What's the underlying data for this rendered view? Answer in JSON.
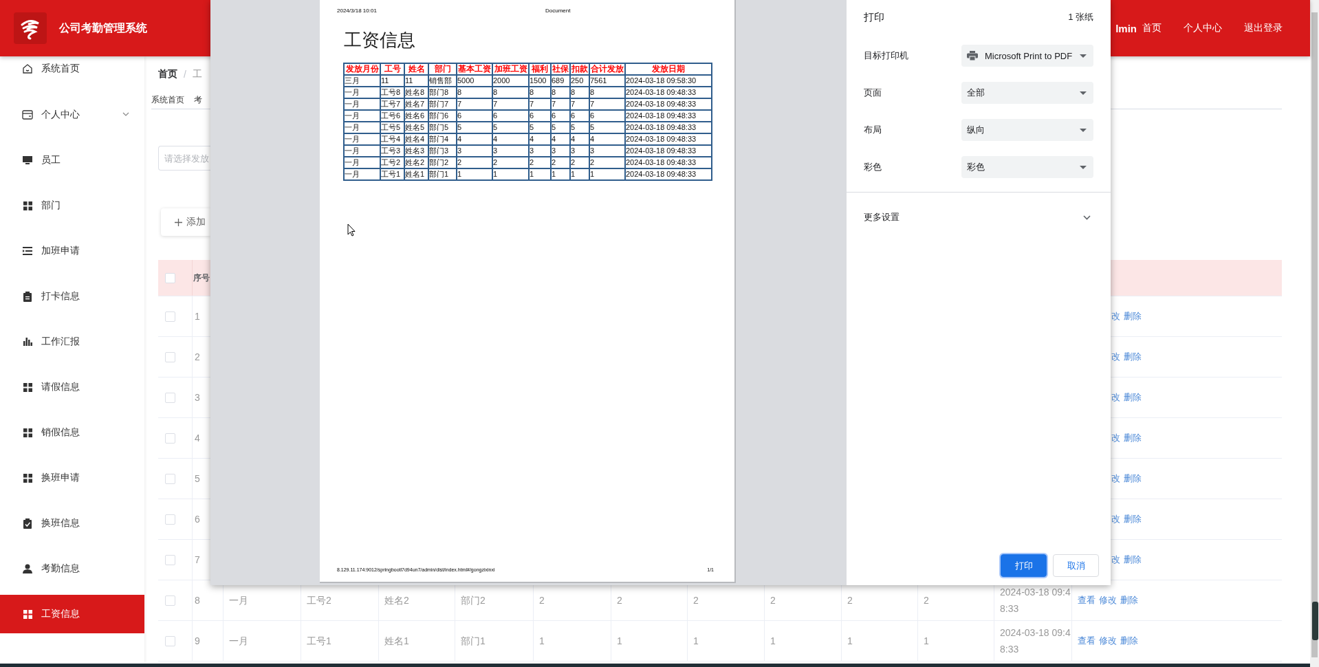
{
  "header": {
    "title": "公司考勤管理系统",
    "user": "lmin",
    "links": [
      "首页",
      "个人中心",
      "退出登录"
    ]
  },
  "sidebar": {
    "items": [
      {
        "label": "系统首页",
        "kind": "link",
        "selected": false
      },
      {
        "label": "个人中心",
        "kind": "group",
        "expanded": false,
        "selected": false
      },
      {
        "label": "员工",
        "kind": "link",
        "selected": false
      },
      {
        "label": "部门",
        "kind": "link",
        "selected": false
      },
      {
        "label": "加班申请",
        "kind": "link",
        "selected": false
      },
      {
        "label": "打卡信息",
        "kind": "link",
        "selected": false
      },
      {
        "label": "工作汇报",
        "kind": "link",
        "selected": false
      },
      {
        "label": "请假信息",
        "kind": "link",
        "selected": false
      },
      {
        "label": "销假信息",
        "kind": "link",
        "selected": false
      },
      {
        "label": "换班申请",
        "kind": "link",
        "selected": false
      },
      {
        "label": "换班信息",
        "kind": "link",
        "selected": false
      },
      {
        "label": "考勤信息",
        "kind": "link",
        "selected": false
      },
      {
        "label": "工资信息",
        "kind": "link",
        "selected": true
      }
    ]
  },
  "breadcrumb": {
    "items": [
      "首页",
      "工"
    ],
    "separator": "/"
  },
  "tags": [
    "系统首页",
    "考"
  ],
  "search": {
    "placeholder": "请选择发放"
  },
  "add_button": "添加",
  "table": {
    "header": {
      "checked": false,
      "column_1": "序号"
    },
    "rows": [
      {
        "checked": false,
        "no": "1",
        "actions": [
          "改",
          "删除"
        ]
      },
      {
        "checked": false,
        "no": "2",
        "actions": [
          "改",
          "删除"
        ]
      },
      {
        "checked": false,
        "no": "3",
        "actions": [
          "改",
          "删除"
        ]
      },
      {
        "checked": false,
        "no": "4",
        "actions": [
          "改",
          "删除"
        ]
      },
      {
        "checked": false,
        "no": "5",
        "actions": [
          "改",
          "删除"
        ]
      },
      {
        "checked": false,
        "no": "6",
        "actions": [
          "改",
          "删除"
        ]
      },
      {
        "checked": false,
        "no": "7",
        "actions": [
          "改",
          "删除"
        ]
      },
      {
        "checked": false,
        "no": "8",
        "cells": [
          "一月",
          "工号2",
          "姓名2",
          "部门2",
          "2",
          "2",
          "2",
          "2",
          "2",
          "2",
          "2024-03-18 09:48:33"
        ],
        "actions": [
          "查看",
          "修改",
          "删除"
        ]
      },
      {
        "checked": false,
        "no": "9",
        "cells": [
          "一月",
          "工号1",
          "姓名1",
          "部门1",
          "1",
          "1",
          "1",
          "1",
          "1",
          "1",
          "2024-03-18 09:48:33"
        ],
        "actions": [
          "查看",
          "修改",
          "删除"
        ]
      }
    ]
  },
  "print_dialog": {
    "preview": {
      "date": "2024/3/18 10:01",
      "doc_title": "Document",
      "heading": "工资信息",
      "table": {
        "columns": [
          "发放月份",
          "工号",
          "姓名",
          "部门",
          "基本工资",
          "加班工资",
          "福利",
          "社保",
          "扣款",
          "合计发放",
          "发放日期"
        ],
        "rows": [
          [
            "三月",
            "11",
            "11",
            "销售部",
            "5000",
            "2000",
            "1500",
            "689",
            "250",
            "7561",
            "2024-03-18 09:58:30"
          ],
          [
            "一月",
            "工号8",
            "姓名8",
            "部门8",
            "8",
            "8",
            "8",
            "8",
            "8",
            "8",
            "2024-03-18 09:48:33"
          ],
          [
            "一月",
            "工号7",
            "姓名7",
            "部门7",
            "7",
            "7",
            "7",
            "7",
            "7",
            "7",
            "2024-03-18 09:48:33"
          ],
          [
            "一月",
            "工号6",
            "姓名6",
            "部门6",
            "6",
            "6",
            "6",
            "6",
            "6",
            "6",
            "2024-03-18 09:48:33"
          ],
          [
            "一月",
            "工号5",
            "姓名5",
            "部门5",
            "5",
            "5",
            "5",
            "5",
            "5",
            "5",
            "2024-03-18 09:48:33"
          ],
          [
            "一月",
            "工号4",
            "姓名4",
            "部门4",
            "4",
            "4",
            "4",
            "4",
            "4",
            "4",
            "2024-03-18 09:48:33"
          ],
          [
            "一月",
            "工号3",
            "姓名3",
            "部门3",
            "3",
            "3",
            "3",
            "3",
            "3",
            "3",
            "2024-03-18 09:48:33"
          ],
          [
            "一月",
            "工号2",
            "姓名2",
            "部门2",
            "2",
            "2",
            "2",
            "2",
            "2",
            "2",
            "2024-03-18 09:48:33"
          ],
          [
            "一月",
            "工号1",
            "姓名1",
            "部门1",
            "1",
            "1",
            "1",
            "1",
            "1",
            "1",
            "2024-03-18 09:48:33"
          ]
        ]
      },
      "url": "8.129.11.174:9012/springbootl7d94un7/admin/dist/index.html#/gongzixinxi",
      "page_number": "1/1"
    },
    "settings": {
      "title": "打印",
      "sheets": "1 张纸",
      "fields": [
        {
          "label": "目标打印机",
          "value": "Microsoft Print to PDF",
          "kind": "printer"
        },
        {
          "label": "页面",
          "value": "全部",
          "kind": "select"
        },
        {
          "label": "布局",
          "value": "纵向",
          "kind": "select"
        },
        {
          "label": "彩色",
          "value": "彩色",
          "kind": "select"
        }
      ],
      "more": {
        "label": "更多设置",
        "expanded": false
      },
      "buttons": [
        {
          "label": "打印",
          "kind": "primary"
        },
        {
          "label": "取消",
          "kind": "secondary"
        }
      ]
    }
  }
}
